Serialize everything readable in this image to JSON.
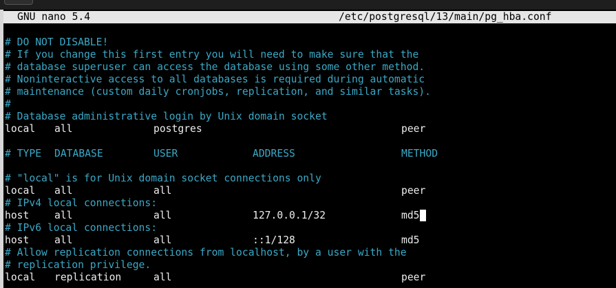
{
  "titlebar": {
    "app": "GNU nano 5.4",
    "file": "/etc/postgresql/13/main/pg_hba.conf"
  },
  "lines": [
    {
      "type": "comment",
      "text": "# DO NOT DISABLE!"
    },
    {
      "type": "comment",
      "text": "# If you change this first entry you will need to make sure that the"
    },
    {
      "type": "comment",
      "text": "# database superuser can access the database using some other method."
    },
    {
      "type": "comment",
      "text": "# Noninteractive access to all databases is required during automatic"
    },
    {
      "type": "comment",
      "text": "# maintenance (custom daily cronjobs, replication, and similar tasks)."
    },
    {
      "type": "comment",
      "text": "#"
    },
    {
      "type": "comment",
      "text": "# Database administrative login by Unix domain socket"
    },
    {
      "type": "entry",
      "cols": [
        "local",
        "all",
        "postgres",
        "",
        "peer"
      ]
    },
    {
      "type": "blank",
      "text": ""
    },
    {
      "type": "header",
      "cols": [
        "# TYPE",
        "DATABASE",
        "USER",
        "ADDRESS",
        "METHOD"
      ]
    },
    {
      "type": "blank",
      "text": ""
    },
    {
      "type": "comment",
      "text": "# \"local\" is for Unix domain socket connections only"
    },
    {
      "type": "entry",
      "cols": [
        "local",
        "all",
        "all",
        "",
        "peer"
      ]
    },
    {
      "type": "comment",
      "text": "# IPv4 local connections:"
    },
    {
      "type": "entry",
      "cols": [
        "host",
        "all",
        "all",
        "127.0.0.1/32",
        "md5"
      ],
      "cursor": true
    },
    {
      "type": "comment",
      "text": "# IPv6 local connections:"
    },
    {
      "type": "entry",
      "cols": [
        "host",
        "all",
        "all",
        "::1/128",
        "md5"
      ]
    },
    {
      "type": "comment",
      "text": "# Allow replication connections from localhost, by a user with the"
    },
    {
      "type": "comment",
      "text": "# replication privilege."
    },
    {
      "type": "entry",
      "cols": [
        "local",
        "replication",
        "all",
        "",
        "peer"
      ]
    }
  ],
  "colors": {
    "comment": "#3aa9c7",
    "text": "#ededed",
    "background": "#000000",
    "titlebar": "#e6e6e6"
  }
}
